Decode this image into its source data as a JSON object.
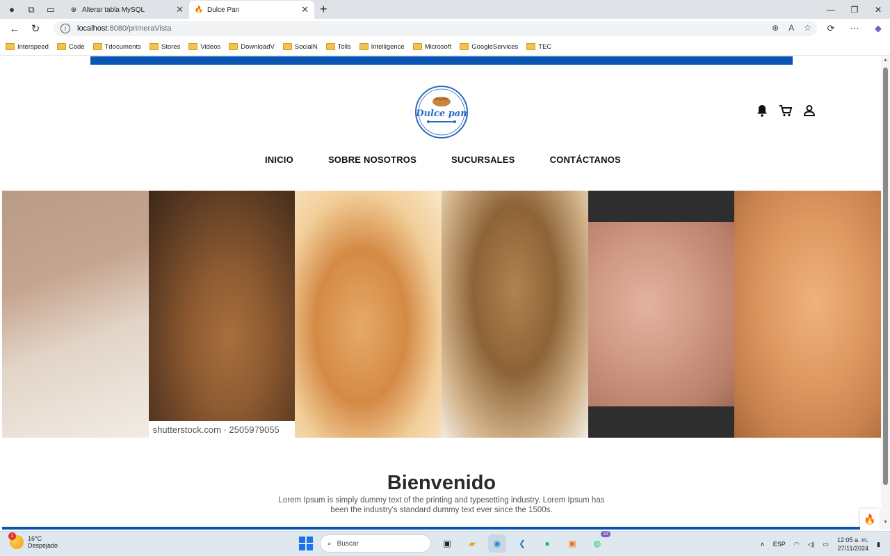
{
  "browser": {
    "tabs": [
      {
        "title": "Alterar tabla MySQL",
        "active": false
      },
      {
        "title": "Dulce Pan",
        "active": true
      }
    ],
    "address": {
      "host": "localhost",
      "path": ":8080/primeraVista"
    },
    "bookmarks": [
      "Interspeed",
      "Code",
      "Tdocuments",
      "Stores",
      "Videos",
      "DownloadV",
      "SocialN",
      "Tolls",
      "Intelligence",
      "Microsoft",
      "GoogleServices",
      "TEC"
    ]
  },
  "site": {
    "brand": {
      "logo_text": "Dulce pan",
      "primary_color": "#0a55b4"
    },
    "menu": [
      "INICIO",
      "SOBRE NOSOTROS",
      "SUCURSALES",
      "CONTÁCTANOS"
    ],
    "header_icons": [
      "bell-icon",
      "cart-icon",
      "user-icon"
    ],
    "gallery_watermark": "shutterstock.com · 2505979055",
    "welcome_title": "Bienvenido",
    "welcome_text": "Lorem Ipsum is simply dummy text of the printing and typesetting industry. Lorem Ipsum has been the industry's standard dummy text ever since the 1500s."
  },
  "taskbar": {
    "weather_temp": "16°C",
    "weather_desc": "Despejado",
    "weather_badge": "1",
    "search_placeholder": "Buscar",
    "whatsapp_badge": "22",
    "lang": "ESP",
    "time": "12:05 a. m.",
    "date": "27/11/2024"
  }
}
